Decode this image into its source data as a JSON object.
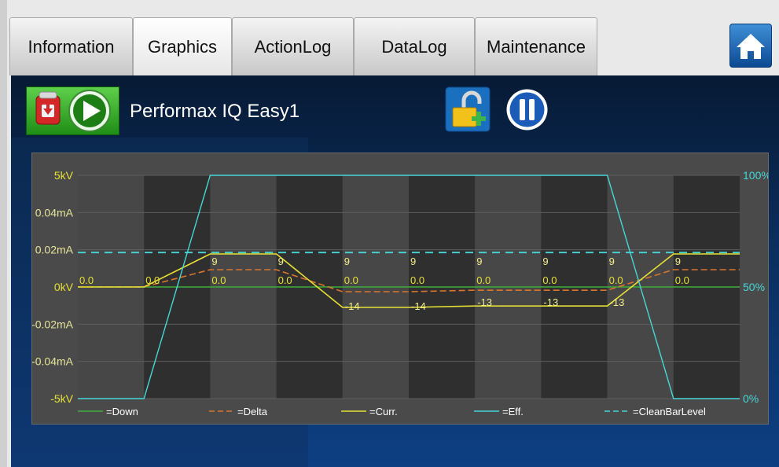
{
  "tabs": [
    {
      "label": "Information"
    },
    {
      "label": "Graphics"
    },
    {
      "label": "ActionLog"
    },
    {
      "label": "DataLog"
    },
    {
      "label": "Maintenance"
    }
  ],
  "active_tab": "Graphics",
  "device_title": "Performax IQ Easy1",
  "icons": {
    "home": "home-icon",
    "battery": "battery-download-icon",
    "play": "play-icon",
    "lock": "unlock-add-icon",
    "pause": "pause-icon"
  },
  "colors": {
    "down": "#3fae3f",
    "delta": "#d9752c",
    "curr": "#e7e035",
    "eff": "#47d6d6",
    "cleanbar": "#47d6d6",
    "axis_left": "#e7e035",
    "axis_right": "#47d6d6"
  },
  "chart_data": {
    "type": "line",
    "y_left_ticks": [
      "5kV",
      "0.04mA",
      "0.02mA",
      "0kV",
      "-0.02mA",
      "-0.04mA",
      "-5kV"
    ],
    "y_right_ticks": [
      "100%",
      "50%",
      "0%"
    ],
    "grid": true,
    "legend_position": "bottom",
    "series": [
      {
        "name": "=Down",
        "values": [
          0.0,
          0.0,
          0.0,
          0.0,
          0.0,
          0.0,
          0.0,
          0.0,
          0.0,
          0.0,
          0.0
        ]
      },
      {
        "name": "=Delta",
        "values": [
          0.0,
          0.0,
          9,
          9,
          -14,
          -14,
          -13,
          -13,
          -13,
          9,
          9
        ]
      },
      {
        "name": "=Curr.",
        "values": [
          0.0,
          0.0,
          9,
          9,
          -14,
          -14,
          -13,
          -13,
          -13,
          9,
          9
        ]
      },
      {
        "name": "=Eff.",
        "values": [
          0,
          0,
          100,
          100,
          100,
          100,
          100,
          100,
          100,
          0,
          0
        ]
      },
      {
        "name": "=CleanBarLevel",
        "values": [
          70,
          70,
          70,
          70,
          70,
          70,
          70,
          70,
          70,
          70,
          70
        ]
      }
    ],
    "labels_zero": [
      "0.0",
      "0.0",
      "0.0",
      "0.0",
      "0.0",
      "0.0",
      "0.0",
      "0.0",
      "0.0",
      "0.0"
    ],
    "labels_top": [
      "9",
      "9",
      "9",
      "9",
      "9",
      "9",
      "9",
      "9"
    ],
    "labels_low": [
      "-14",
      "-14",
      "-13",
      "-13",
      "-13"
    ]
  }
}
